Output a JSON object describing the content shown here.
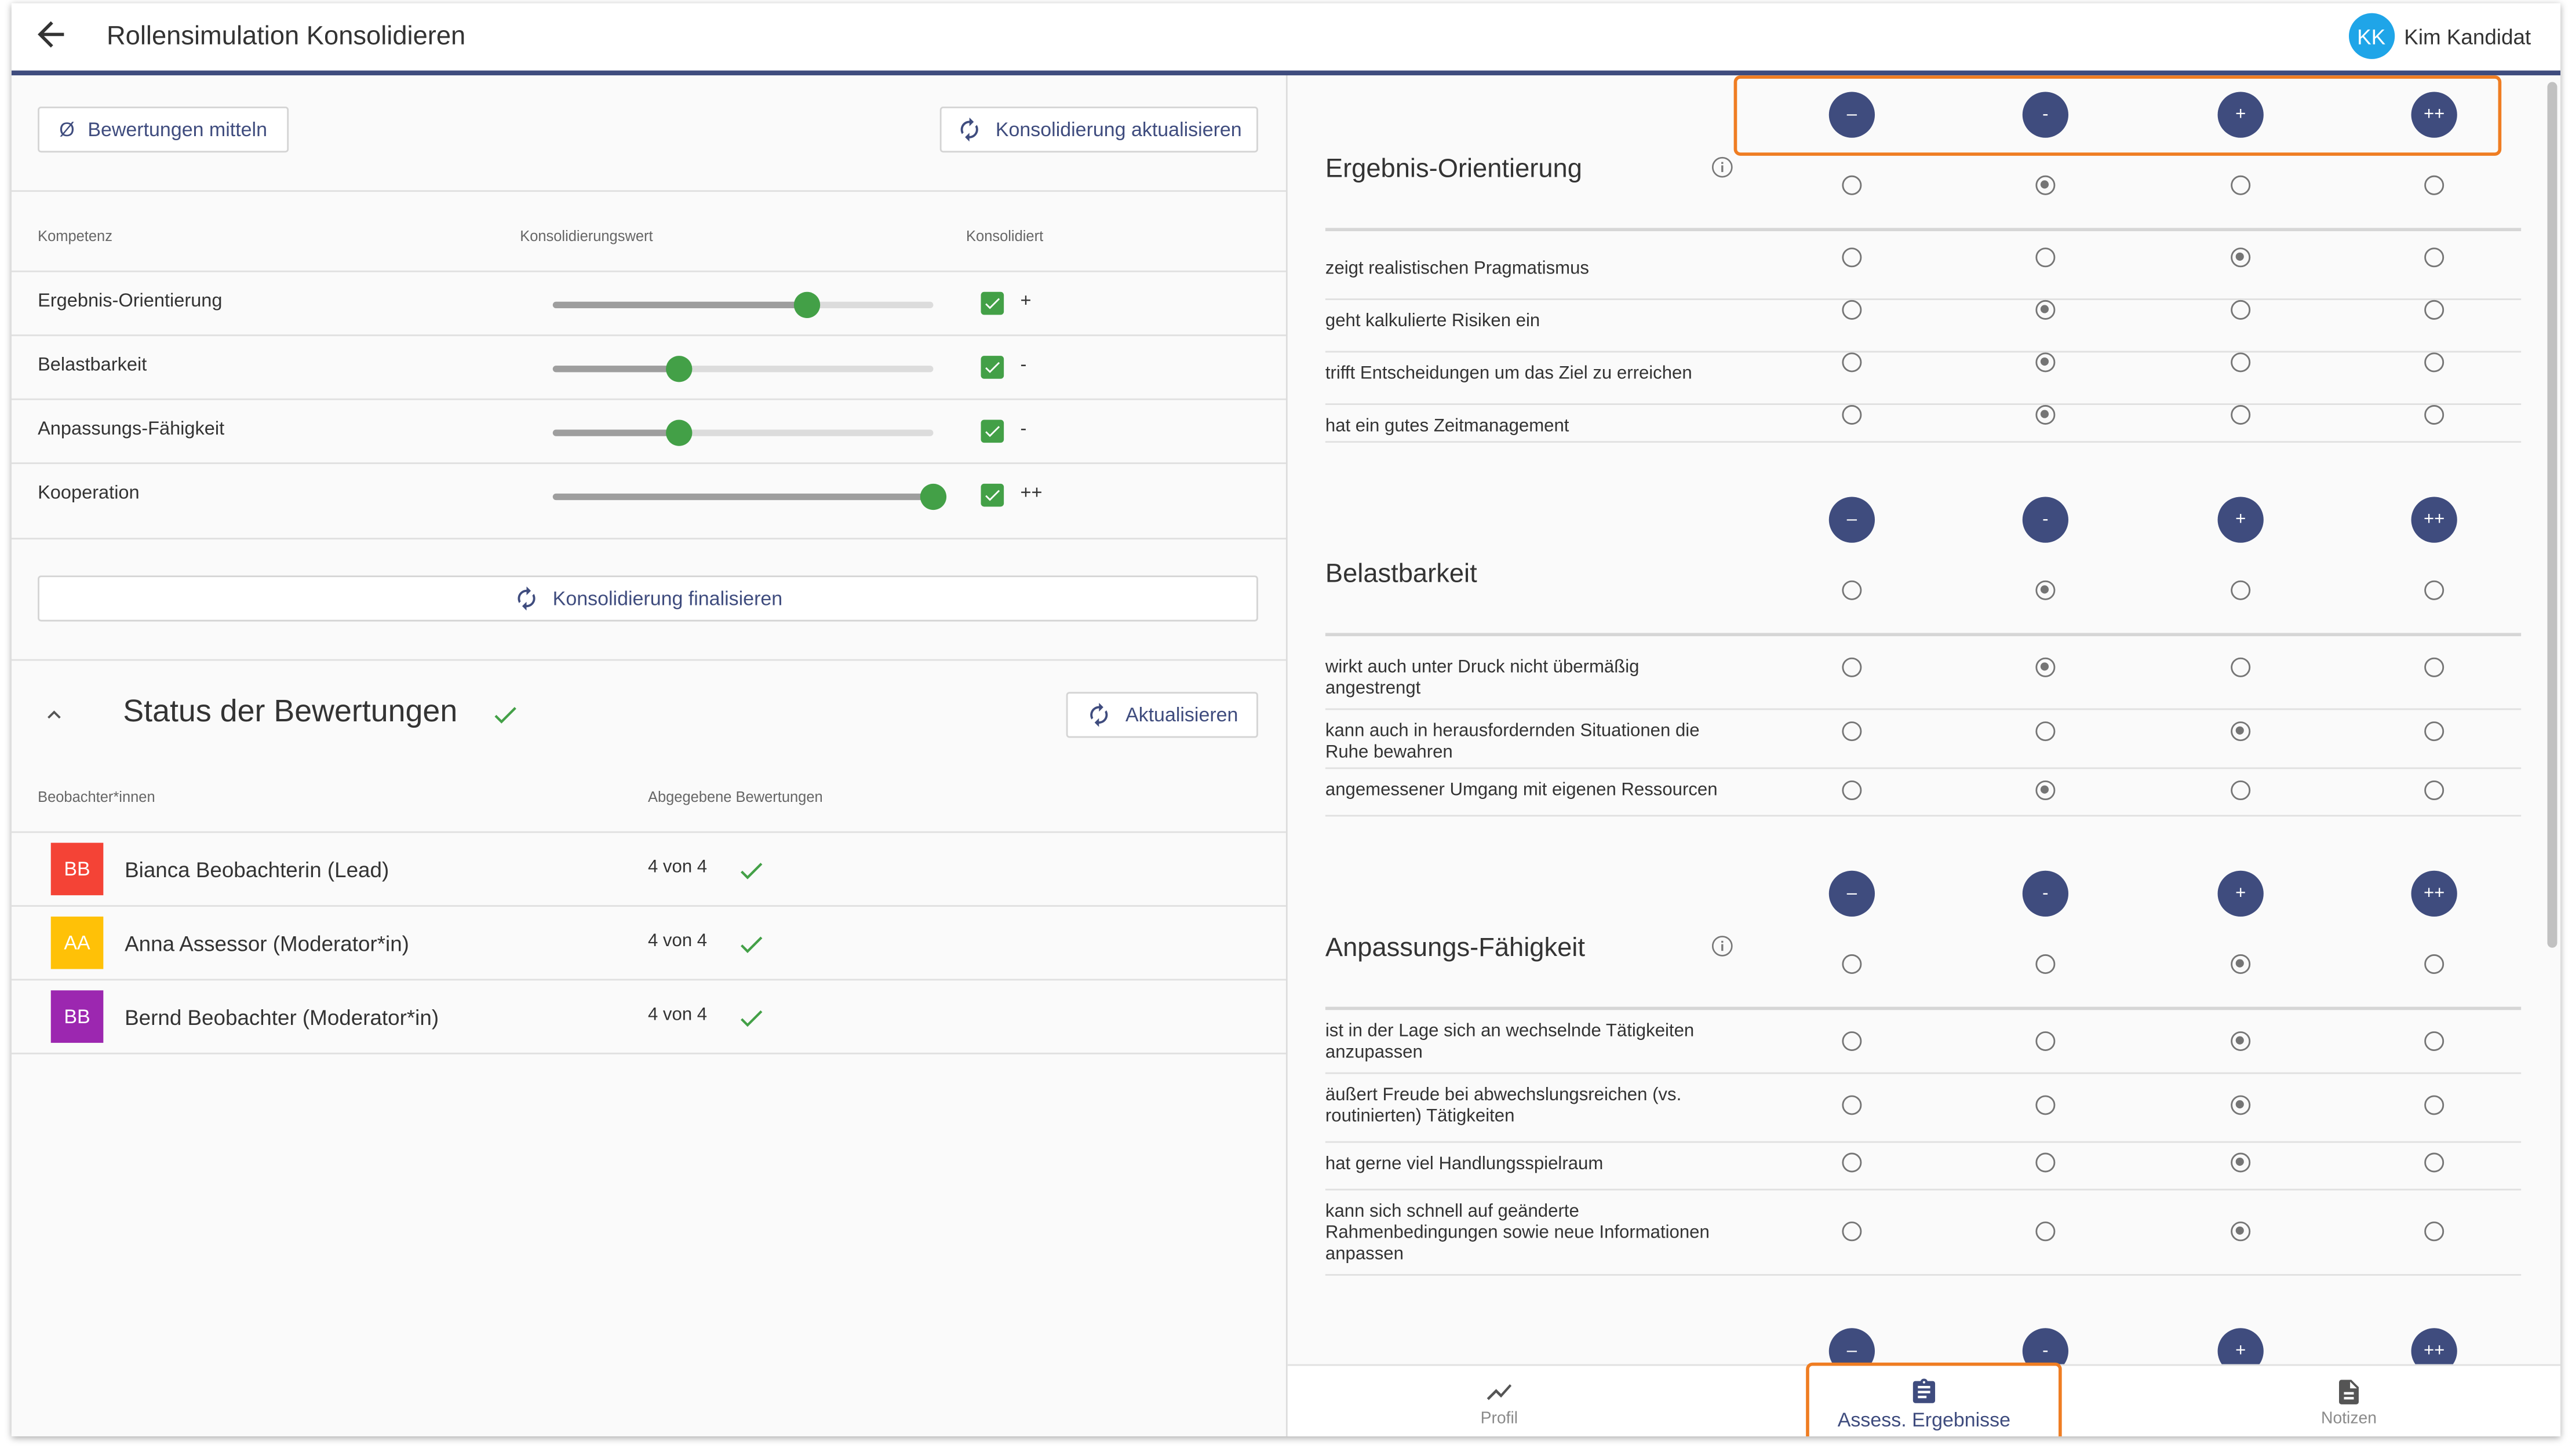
{
  "header": {
    "title": "Rollensimulation Konsolidieren",
    "user": {
      "initials": "KK",
      "name": "Kim Kandidat"
    }
  },
  "left": {
    "average_button": {
      "symbol": "Ø",
      "label": "Bewertungen mitteln"
    },
    "update_consolidation_button": "Konsolidierung aktualisieren",
    "table_headers": {
      "competence": "Kompetenz",
      "value": "Konsolidierungswert",
      "consolidated": "Konsolidiert"
    },
    "competencies": [
      {
        "name": "Ergebnis-Orientierung",
        "slider_fraction": 0.667,
        "checked": true,
        "label": "+"
      },
      {
        "name": "Belastbarkeit",
        "slider_fraction": 0.333,
        "checked": true,
        "label": "-"
      },
      {
        "name": "Anpassungs-Fähigkeit",
        "slider_fraction": 0.333,
        "checked": true,
        "label": "-"
      },
      {
        "name": "Kooperation",
        "slider_fraction": 1.0,
        "checked": true,
        "label": "++"
      }
    ],
    "finalize_button": "Konsolidierung finalisieren",
    "status": {
      "title": "Status der Bewertungen",
      "refresh_button": "Aktualisieren",
      "headers": {
        "observers": "Beobachter*innen",
        "submitted": "Abgegebene Bewertungen"
      },
      "observers": [
        {
          "initials": "BB",
          "name": "Bianca Beobachterin (Lead)",
          "count": "4 von 4",
          "color": "#f44336"
        },
        {
          "initials": "AA",
          "name": "Anna Assessor (Moderator*in)",
          "count": "4 von 4",
          "color": "#ffc107"
        },
        {
          "initials": "BB",
          "name": "Bernd Beobachter (Moderator*in)",
          "count": "4 von 4",
          "color": "#9c27b0"
        }
      ]
    }
  },
  "right": {
    "scale": [
      "–",
      "-",
      "+",
      "++"
    ],
    "sections": [
      {
        "title": "Ergebnis-Orientierung",
        "info": true,
        "selected": 1,
        "items": [
          {
            "text": "zeigt realistischen Pragmatismus",
            "selected": 2
          },
          {
            "text": "geht kalkulierte Risiken ein",
            "selected": 1
          },
          {
            "text": "trifft Entscheidungen um das Ziel zu erreichen",
            "selected": 1
          },
          {
            "text": "hat ein gutes Zeitmanagement",
            "selected": 1
          }
        ]
      },
      {
        "title": "Belastbarkeit",
        "info": false,
        "selected": 1,
        "items": [
          {
            "text": "wirkt auch unter Druck nicht übermäßig angestrengt",
            "selected": 1
          },
          {
            "text": "kann auch in herausfordernden Situationen die Ruhe bewahren",
            "selected": 2
          },
          {
            "text": "angemessener Umgang mit eigenen Ressourcen",
            "selected": 1
          }
        ]
      },
      {
        "title": "Anpassungs-Fähigkeit",
        "info": true,
        "selected": 2,
        "items": [
          {
            "text": "ist in der Lage sich an wechselnde Tätigkeiten anzupassen",
            "selected": 2
          },
          {
            "text": "äußert Freude bei abwechslungsreichen (vs. routinierten) Tätigkeiten",
            "selected": 2
          },
          {
            "text": "hat gerne viel Handlungsspielraum",
            "selected": 2
          },
          {
            "text": "kann sich schnell auf geänderte Rahmenbedingungen sowie neue Informationen anpassen",
            "selected": 2
          }
        ]
      }
    ]
  },
  "bottom_nav": [
    {
      "label": "Profil",
      "icon": "chart-line-icon",
      "active": false
    },
    {
      "label": "Assess. Ergebnisse",
      "icon": "clipboard-icon",
      "active": true
    },
    {
      "label": "Notizen",
      "icon": "document-icon",
      "active": false
    }
  ],
  "colors": {
    "primary": "#3f4c7e",
    "accent_green": "#43a047",
    "highlight_orange": "#ef7d22",
    "avatar_blue": "#1fa5e8"
  }
}
